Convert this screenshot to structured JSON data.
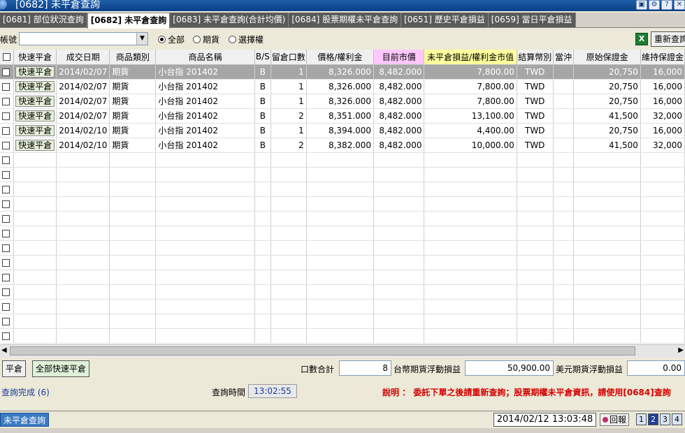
{
  "window": {
    "title": "[0682] 未平倉查詢"
  },
  "tabs": [
    {
      "label": "[0681] 部位狀況查詢",
      "active": false
    },
    {
      "label": "[0682] 未平倉查詢",
      "active": true
    },
    {
      "label": "[0683] 未平倉查詢(合計均價)",
      "active": false
    },
    {
      "label": "[0684] 股票期權未平倉查詢",
      "active": false
    },
    {
      "label": "[0651] 歷史平倉損益",
      "active": false
    },
    {
      "label": "[0659] 當日平倉損益",
      "active": false
    }
  ],
  "filter": {
    "account_label": "帳號",
    "account_value": "",
    "radios": [
      {
        "label": "全部",
        "checked": true
      },
      {
        "label": "期貨",
        "checked": false
      },
      {
        "label": "選擇權",
        "checked": false
      }
    ],
    "excel_icon": "excel-icon",
    "requery_label": "重新查詢"
  },
  "table": {
    "headers": [
      "快速平倉",
      "成交日期",
      "商品類別",
      "商品名稱",
      "B/S",
      "留倉口數",
      "價格/權利金",
      "目前市價",
      "未平倉損益/權利金市值",
      "結算幣別",
      "當沖",
      "原始保證金",
      "維持保證金"
    ],
    "quick_close_label": "快速平倉",
    "rows": [
      [
        "2014/02/07",
        "期貨",
        "小台指 201402",
        "B",
        "1",
        "8,326.000",
        "8,482.000",
        "7,800.00",
        "TWD",
        "",
        "20,750",
        "16,000"
      ],
      [
        "2014/02/07",
        "期貨",
        "小台指 201402",
        "B",
        "1",
        "8,326.000",
        "8,482.000",
        "7,800.00",
        "TWD",
        "",
        "20,750",
        "16,000"
      ],
      [
        "2014/02/07",
        "期貨",
        "小台指 201402",
        "B",
        "1",
        "8,326.000",
        "8,482.000",
        "7,800.00",
        "TWD",
        "",
        "20,750",
        "16,000"
      ],
      [
        "2014/02/07",
        "期貨",
        "小台指 201402",
        "B",
        "2",
        "8,351.000",
        "8,482.000",
        "13,100.00",
        "TWD",
        "",
        "41,500",
        "32,000"
      ],
      [
        "2014/02/10",
        "期貨",
        "小台指 201402",
        "B",
        "1",
        "8,394.000",
        "8,482.000",
        "4,400.00",
        "TWD",
        "",
        "20,750",
        "16,000"
      ],
      [
        "2014/02/10",
        "期貨",
        "小台指 201402",
        "B",
        "2",
        "8,382.000",
        "8,482.000",
        "10,000.00",
        "TWD",
        "",
        "41,500",
        "32,000"
      ]
    ],
    "selected_row": 0,
    "empty_rows": 13
  },
  "bottom": {
    "close_label": "平倉",
    "close_all_label": "全部快速平倉",
    "qty_total_label": "口數合計",
    "qty_total_value": "8",
    "twd_float_label": "台幣期貨浮動損益",
    "twd_float_value": "50,900.00",
    "usd_float_label": "美元期貨浮動損益",
    "usd_float_value": "0.00"
  },
  "status": {
    "message": "查詢完成 (6)",
    "query_time_label": "查詢時間",
    "query_time_value": "13:02:55",
    "note": "說明 ： 委託下單之後請重新查詢；股票期權未平倉資訊，請使用[0684]查詢"
  },
  "footer": {
    "tab_label": "未平倉查詢",
    "datetime": "2014/02/12 13:03:48",
    "return_label": "回報",
    "pages": [
      "1",
      "2",
      "3",
      "4"
    ],
    "active_page": "2"
  }
}
